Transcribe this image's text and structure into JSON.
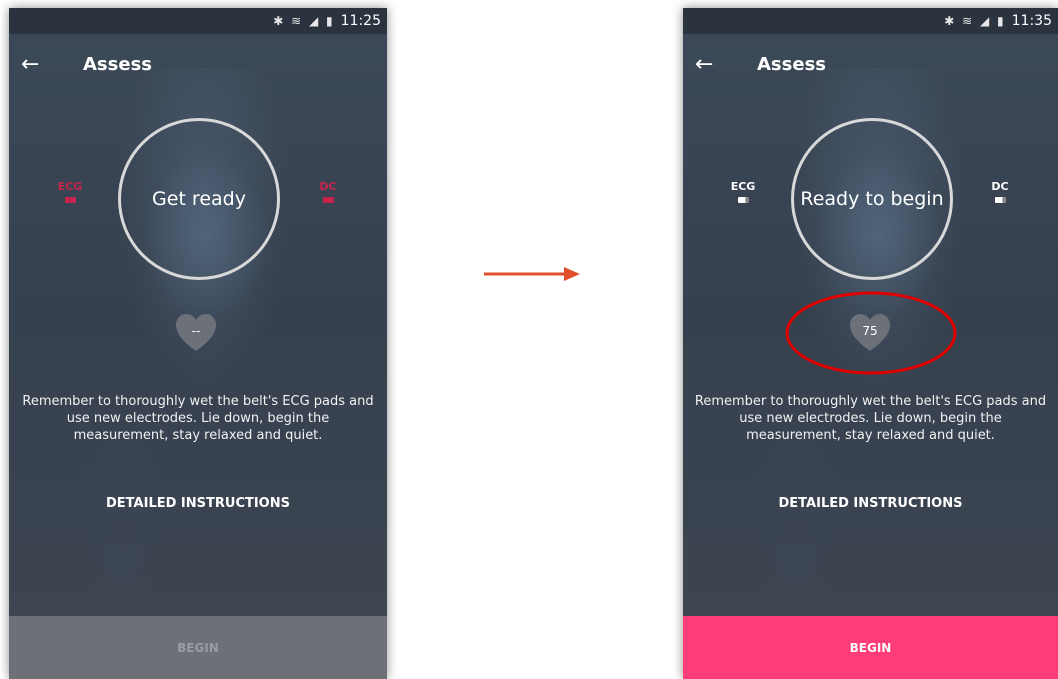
{
  "colors": {
    "accent_pink": "#ff3c7a",
    "disconnected_red": "#c8234a",
    "annotation_red": "#e00000",
    "arrow_orange": "#e0502a"
  },
  "screens": [
    {
      "status_time": "11:25",
      "status_icons": "✱ ≋ ◢ ▮",
      "title": "Assess",
      "ring_label": "Get ready",
      "sensor_left": "ECG",
      "sensor_right": "DC",
      "sensors_connected": false,
      "heart_rate": "--",
      "message": "Remember to thoroughly wet the belt's ECG pads and use new electrodes. Lie down, begin the measurement, stay relaxed and quiet.",
      "detail_link": "DETAILED INSTRUCTIONS",
      "begin_label": "BEGIN",
      "begin_enabled": false
    },
    {
      "status_time": "11:35",
      "status_icons": "✱ ≋ ◢ ▮",
      "title": "Assess",
      "ring_label": "Ready to begin",
      "sensor_left": "ECG",
      "sensor_right": "DC",
      "sensors_connected": true,
      "heart_rate": "75",
      "message": "Remember to thoroughly wet the belt's ECG pads and use new electrodes. Lie down, begin the measurement, stay relaxed and quiet.",
      "detail_link": "DETAILED INSTRUCTIONS",
      "begin_label": "BEGIN",
      "begin_enabled": true
    }
  ],
  "annotations": {
    "transition_arrow": "right-arrow-icon",
    "highlight": "heart-rate-circle-highlight"
  }
}
